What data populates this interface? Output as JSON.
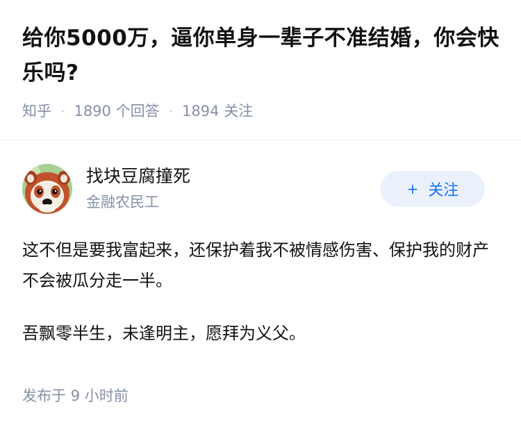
{
  "question": {
    "title": "给你5000万，逼你单身一辈子不准结婚，你会快乐吗?",
    "source": "知乎",
    "answers_count": "1890",
    "answers_label": "个回答",
    "followers_count": "1894",
    "followers_label": "关注"
  },
  "author": {
    "name": "找块豆腐撞死",
    "headline": "金融农民工",
    "avatar_icon": "red-panda-avatar",
    "follow_label": "关注",
    "follow_icon": "plus-icon"
  },
  "answer": {
    "paragraphs": [
      "这不但是要我富起来，还保护着我不被情感伤害、保护我的财产不会被瓜分走一半。",
      "吾飘零半生，未逢明主，愿拜为义父。"
    ],
    "publish_label": "发布于",
    "publish_time": "9 小时前"
  },
  "colors": {
    "title": "#121212",
    "meta": "#8590a6",
    "accent": "#1772f6",
    "follow_bg": "#eaf1fa",
    "divider": "#ebebeb"
  }
}
